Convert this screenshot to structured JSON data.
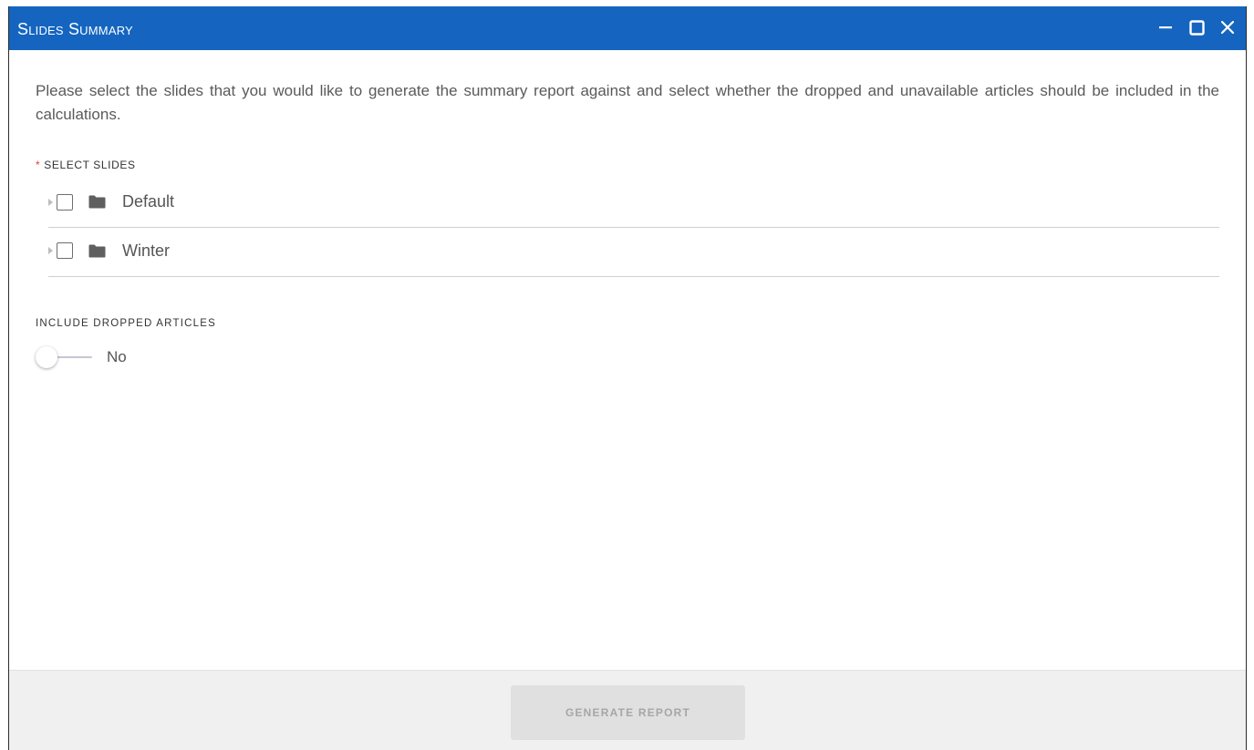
{
  "window": {
    "title": "Slides Summary",
    "controls": {
      "minimize_icon": "minimize-icon",
      "maximize_icon": "maximize-icon",
      "close_icon": "close-icon"
    }
  },
  "description": "Please select the slides that you would like to generate the summary report against and select whether the dropped and unavailable articles should be included in the calculations.",
  "select_slides": {
    "required_marker": "*",
    "label": "SELECT SLIDES",
    "items": [
      {
        "label": "Default",
        "checked": false,
        "icon": "folder-icon"
      },
      {
        "label": "Winter",
        "checked": false,
        "icon": "folder-icon"
      }
    ]
  },
  "include_dropped": {
    "label": "INCLUDE DROPPED ARTICLES",
    "value_text": "No",
    "enabled": false
  },
  "footer": {
    "generate_label": "GENERATE REPORT",
    "generate_disabled": true
  },
  "colors": {
    "titlebar": "#1565c0",
    "required": "#e53935",
    "footer_bg": "#f0f0f0",
    "button_disabled_bg": "#e0e0e0",
    "button_disabled_text": "#a6a6a6"
  }
}
